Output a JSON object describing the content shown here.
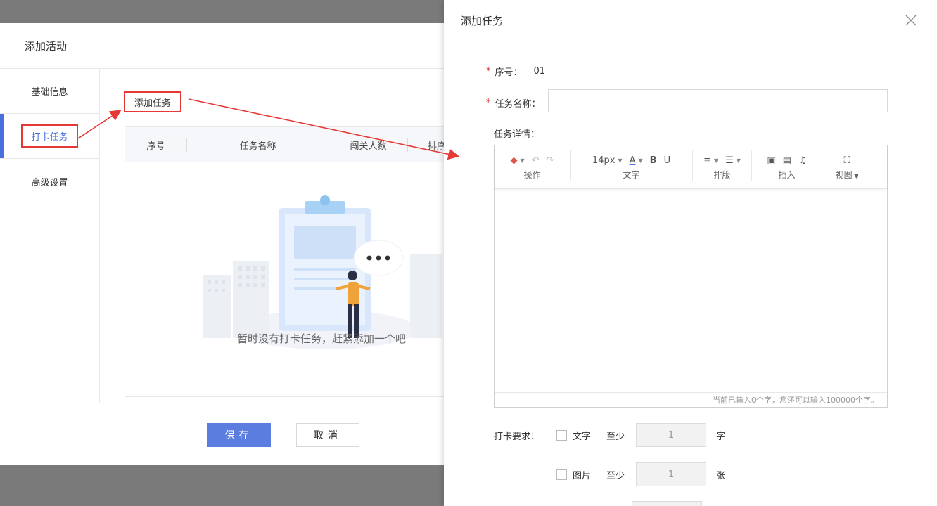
{
  "modal": {
    "title": "添加活动",
    "sidebar": [
      {
        "label": "基础信息"
      },
      {
        "label": "打卡任务"
      },
      {
        "label": "高级设置"
      }
    ],
    "add_task_button": "添加任务",
    "table_headers": [
      "序号",
      "任务名称",
      "闯关人数",
      "排序"
    ],
    "empty_text": "暂时没有打卡任务，赶紧添加一个吧",
    "save_label": "保存",
    "cancel_label": "取消"
  },
  "drawer": {
    "title": "添加任务",
    "fields": {
      "seq_label": "序号：",
      "seq_value": "01",
      "name_label": "任务名称：",
      "name_value": "",
      "detail_label": "任务详情："
    },
    "editor": {
      "font_size": "14px",
      "groups": [
        "操作",
        "文字",
        "排版",
        "插入",
        "视图"
      ],
      "status": "当前已输入0个字，您还可以输入100000个字。"
    },
    "requirements": {
      "label": "打卡要求：",
      "items": [
        {
          "label": "文字",
          "at_least": "至少",
          "value": "1",
          "unit": "字"
        },
        {
          "label": "图片",
          "at_least": "至少",
          "value": "1",
          "unit": "张"
        }
      ]
    }
  },
  "colors": {
    "accent": "#5b7de0",
    "annotation": "#e53935",
    "overlay": "#7a7a7a"
  }
}
